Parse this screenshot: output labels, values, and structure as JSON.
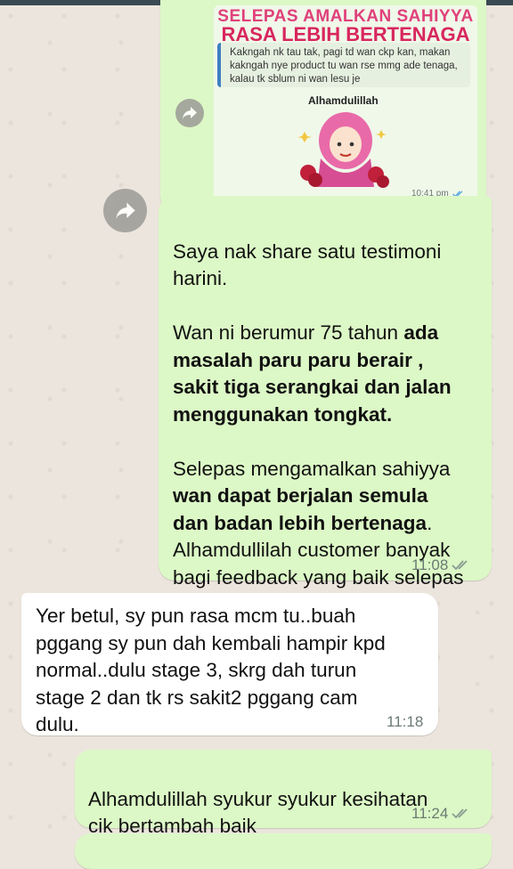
{
  "image_message": {
    "banner_line1": "SELEPAS AMALKAN SAHIYYA",
    "banner_line2": "RASA LEBIH BERTENAGA",
    "quoted_text": "Kakngah nk tau tak, pagi td wan ckp kan, makan kakngah nye product tu wan rse mmg ade tenaga, kalau tk sblum ni wan lesu je",
    "sticker_caption": "Alhamdulillah",
    "time": "10:41 pm"
  },
  "messages": [
    {
      "id": "m1",
      "direction": "outgoing",
      "time": "11:08",
      "parts": {
        "p1": "Saya nak share satu testimoni\nharini.",
        "p2a": "Wan ni berumur 75 tahun ",
        "p2b": "ada\nmasalah paru paru berair ,\nsakit tiga serangkai dan jalan\nmenggunakan tongkat.",
        "p3a": "Selepas mengamalkan sahiyya\n",
        "p3b": "wan dapat berjalan semula\ndan badan lebih bertenaga",
        "p3c": ".\nAlhamdullilah customer banyak\nbagi feedback yang baik selepas\nambil Sahiyya"
      }
    },
    {
      "id": "m2",
      "direction": "incoming",
      "time": "11:18",
      "text": "Yer betul, sy pun rasa mcm tu..buah\npggang sy pun dah kembali hampir kpd\nnormal..dulu stage 3, skrg dah turun\nstage 2 dan tk rs sakit2 pggang cam\ndulu."
    },
    {
      "id": "m3",
      "direction": "outgoing",
      "time": "11:24",
      "text": "Alhamdulillah syukur syukur  kesihatan\ncik bertambah baik"
    }
  ],
  "icons": {
    "forward": "forward-arrow-icon",
    "read_receipt": "double-check-icon",
    "emoji": "smiling-face-with-hearts-icon"
  },
  "colors": {
    "outgoing_bubble": "#dcf8c6",
    "incoming_bubble": "#ffffff",
    "background": "#ece5dd",
    "tick_read": "#4fa3e0",
    "tick_grey": "#8a9a92"
  }
}
